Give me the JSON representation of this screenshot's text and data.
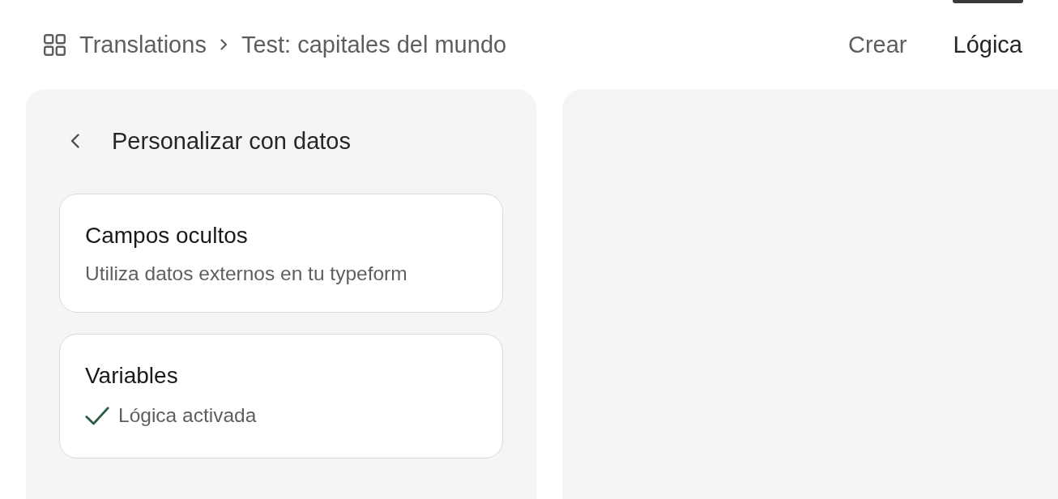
{
  "breadcrumb": {
    "items": [
      "Translations",
      "Test: capitales del mundo"
    ]
  },
  "tabs": [
    {
      "label": "Crear",
      "selected": false
    },
    {
      "label": "Lógica",
      "selected": true
    }
  ],
  "sidebar": {
    "title": "Personalizar con datos",
    "cards": [
      {
        "kind": "description",
        "title": "Campos ocultos",
        "text": "Utiliza datos externos en tu typeform"
      },
      {
        "kind": "status",
        "title": "Variables",
        "text": "Lógica activada",
        "checked": true
      }
    ]
  }
}
